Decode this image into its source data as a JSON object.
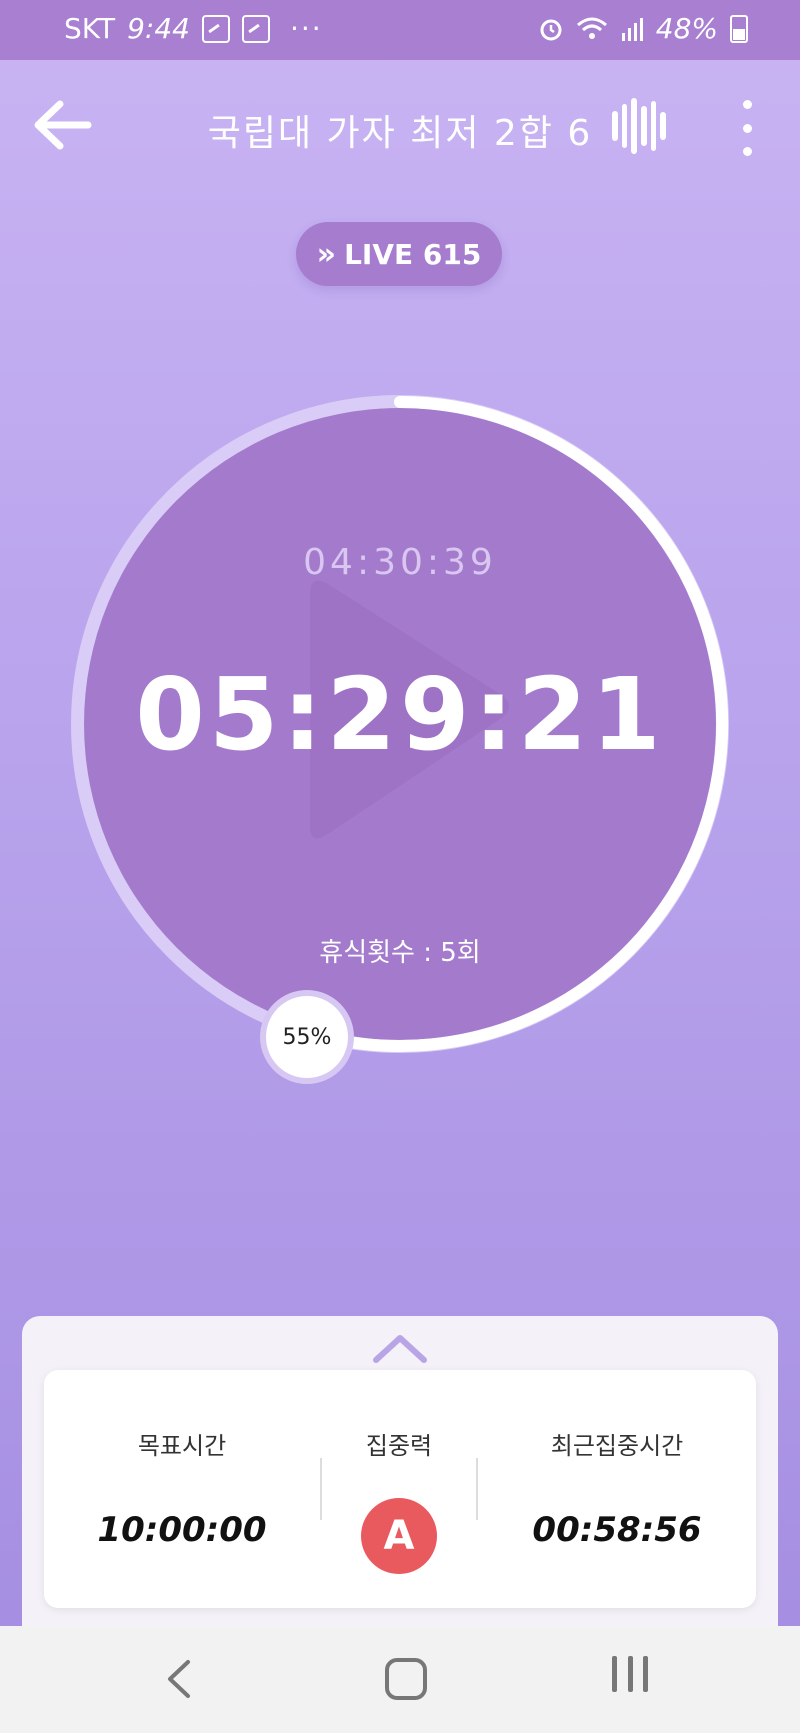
{
  "status_bar": {
    "carrier": "SKT",
    "time": "9:44",
    "overflow": "···",
    "battery": "48%"
  },
  "app_bar": {
    "title": "국립대 가자 최저 2합 6"
  },
  "live": {
    "label": "LIVE 615",
    "chevron": "»"
  },
  "timer": {
    "main_time": "05:29:21",
    "sub_time": "04:30:39",
    "rest_count": "휴식횟수 : 5회",
    "progress_label": "55%",
    "progress": 0.55
  },
  "stats": {
    "goal_label": "목표시간",
    "goal_value": "10:00:00",
    "focus_label": "집중력",
    "focus_grade": "A",
    "recent_label": "최근집중시간",
    "recent_value": "00:58:56"
  },
  "colors": {
    "accent": "#a67ccf",
    "circle_fill": "#a47bcc",
    "grade_badge": "#e95a5f",
    "status_bar": "#a87fd1"
  }
}
